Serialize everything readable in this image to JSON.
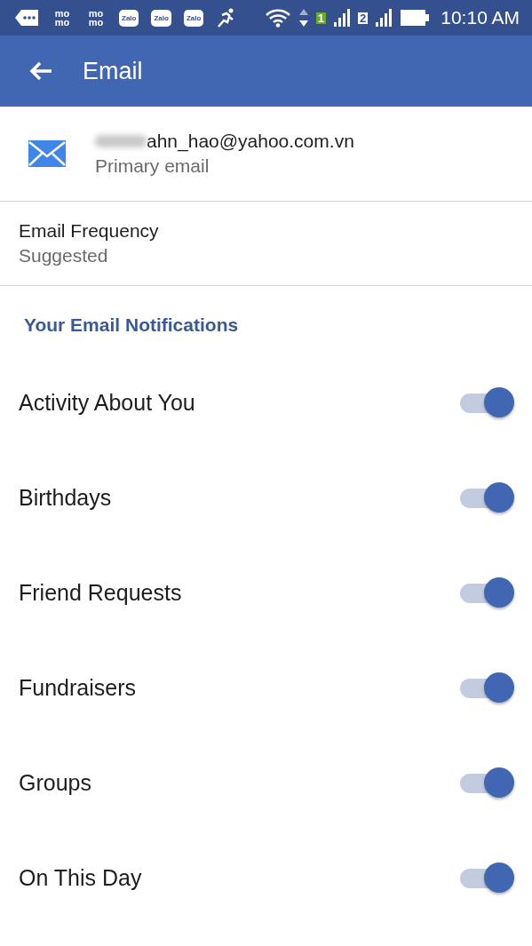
{
  "status_bar": {
    "notification_icons": [
      {
        "kind": "dots"
      },
      {
        "kind": "momo",
        "label": "mo mo"
      },
      {
        "kind": "momo",
        "label": "mo mo"
      },
      {
        "kind": "zalo",
        "label": "Zalo"
      },
      {
        "kind": "zalo",
        "label": "Zalo"
      },
      {
        "kind": "zalo",
        "label": "Zalo"
      },
      {
        "kind": "runner"
      }
    ],
    "sims": [
      {
        "label": "1",
        "active": true
      },
      {
        "label": "2",
        "active": false
      }
    ],
    "time": "10:10 AM"
  },
  "app_bar": {
    "title": "Email"
  },
  "email": {
    "address": "ahn_hao@yahoo.com.vn",
    "redacted": true,
    "caption": "Primary email"
  },
  "frequency": {
    "label": "Email Frequency",
    "value": "Suggested"
  },
  "section_title": "Your Email Notifications",
  "settings": [
    {
      "label": "Activity About You",
      "on": true
    },
    {
      "label": "Birthdays",
      "on": true
    },
    {
      "label": "Friend Requests",
      "on": true
    },
    {
      "label": "Fundraisers",
      "on": true
    },
    {
      "label": "Groups",
      "on": true
    },
    {
      "label": "On This Day",
      "on": true
    }
  ]
}
